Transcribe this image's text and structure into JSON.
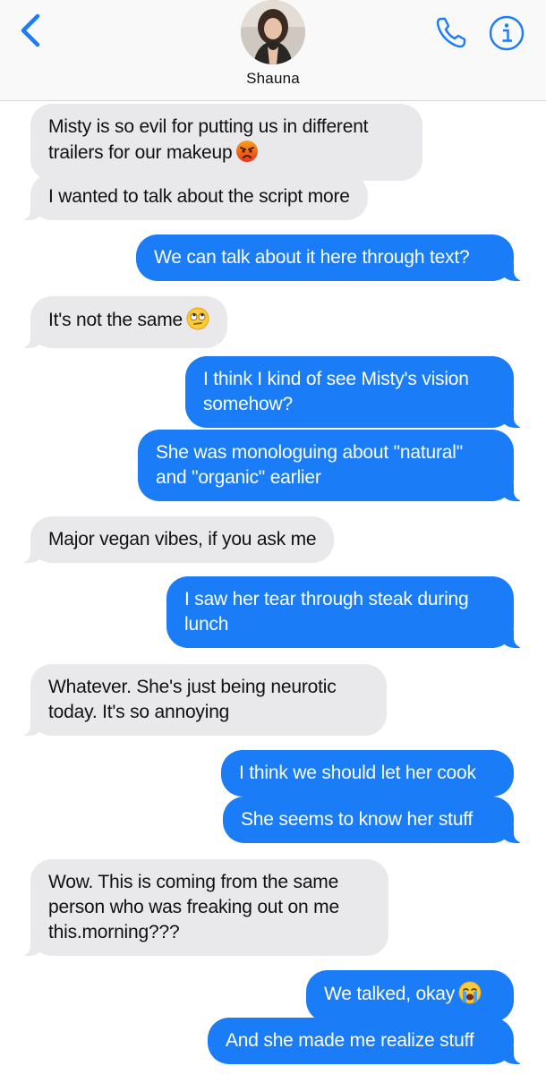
{
  "header": {
    "contact_name": "Shauna",
    "back_icon": "chevron-left-icon",
    "phone_icon": "phone-icon",
    "info_icon": "info-icon",
    "accent_color": "#1a7cf7"
  },
  "messages": [
    {
      "direction": "incoming",
      "lines": [
        "Misty is so evil for putting us in different",
        "trailers for our makeup"
      ],
      "emoji": "angry-face-emoji"
    },
    {
      "direction": "incoming",
      "lines": [
        "I wanted to talk about the script more"
      ]
    },
    {
      "direction": "outgoing",
      "lines": [
        "We can talk about it here through text?"
      ]
    },
    {
      "direction": "incoming",
      "lines": [
        "It's not the same"
      ],
      "emoji": "eye-roll-emoji"
    },
    {
      "direction": "outgoing",
      "lines": [
        "I think I kind of see Misty's vision",
        "somehow?"
      ]
    },
    {
      "direction": "outgoing",
      "lines": [
        "She was monologuing about \"natural\"",
        "and \"organic\" earlier"
      ]
    },
    {
      "direction": "incoming",
      "lines": [
        "Major vegan vibes, if you ask me"
      ]
    },
    {
      "direction": "outgoing",
      "lines": [
        "I saw her tear through steak during",
        "lunch"
      ]
    },
    {
      "direction": "incoming",
      "lines": [
        "Whatever. She's just being neurotic",
        "today. It's so annoying"
      ]
    },
    {
      "direction": "outgoing",
      "lines": [
        "I think we should let her cook"
      ]
    },
    {
      "direction": "outgoing",
      "lines": [
        "She seems to know her stuff"
      ]
    },
    {
      "direction": "incoming",
      "lines": [
        "Wow. This is coming from the same",
        "person who was freaking out on me",
        "this.morning???"
      ]
    },
    {
      "direction": "outgoing",
      "lines": [
        "We talked, okay"
      ],
      "emoji": "crying-face-emoji"
    },
    {
      "direction": "outgoing",
      "lines": [
        "And she made me realize stuff"
      ]
    }
  ]
}
